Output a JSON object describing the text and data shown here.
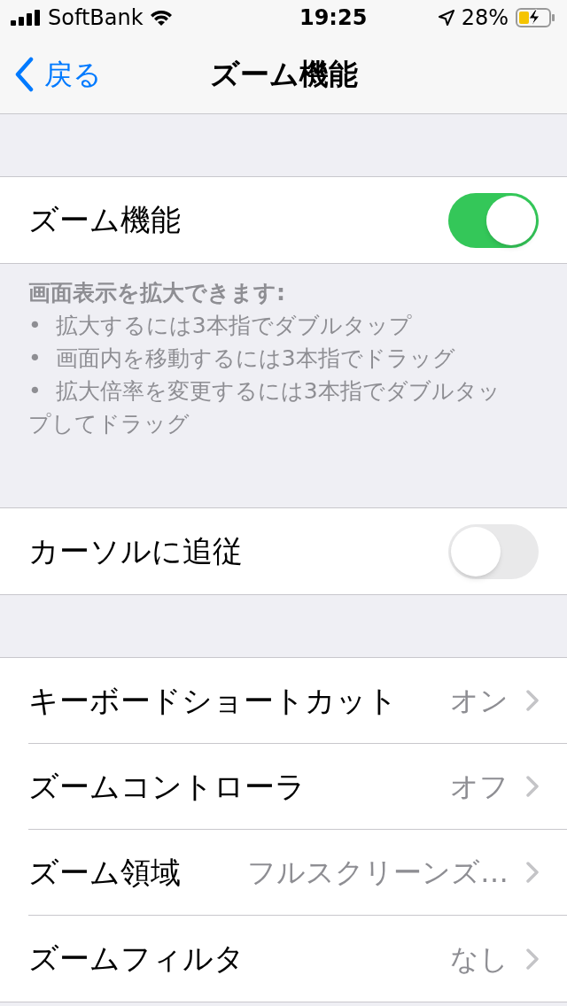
{
  "status_bar": {
    "carrier": "SoftBank",
    "time": "19:25",
    "battery": "28%"
  },
  "nav": {
    "back": "戻る",
    "title": "ズーム機能"
  },
  "sections": [
    {
      "rows": [
        {
          "kind": "toggle",
          "label": "ズーム機能",
          "on": true
        }
      ],
      "footer": {
        "heading": "画面表示を拡大できます:",
        "bullets": [
          {
            "marker": "•",
            "text": "拡大するには3本指でダブルタップ"
          },
          {
            "marker": "•",
            "text": "画面内を移動するには3本指でドラッグ"
          },
          {
            "marker": "•",
            "text": "拡大倍率を変更するには3本指でダブルタップしてドラッグ"
          }
        ]
      }
    },
    {
      "rows": [
        {
          "kind": "toggle",
          "label": "カーソルに追従",
          "on": false
        }
      ]
    },
    {
      "rows": [
        {
          "kind": "link",
          "label": "キーボードショートカット",
          "value": "オン"
        },
        {
          "kind": "link",
          "label": "ズームコントローラ",
          "value": "オフ"
        },
        {
          "kind": "link",
          "label": "ズーム領域",
          "value": "フルスクリーンズ…"
        },
        {
          "kind": "link",
          "label": "ズームフィルタ",
          "value": "なし"
        }
      ]
    }
  ]
}
